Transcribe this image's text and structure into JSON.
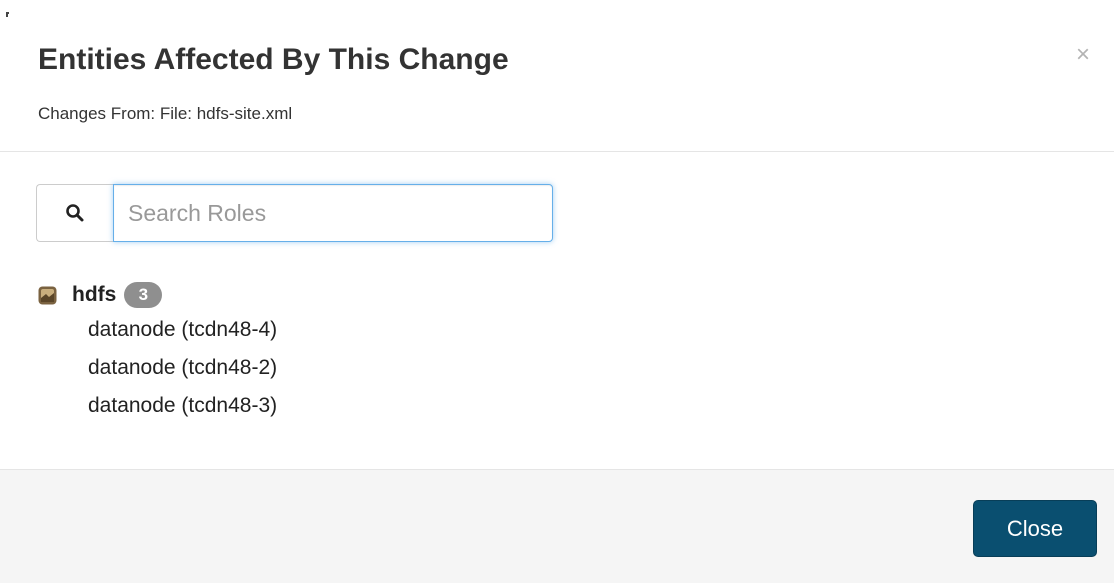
{
  "modal": {
    "title": "Entities Affected By This Change",
    "subtitle": "Changes From: File: hdfs-site.xml",
    "close_x": "×"
  },
  "search": {
    "icon": "search-icon",
    "placeholder": "Search Roles",
    "value": ""
  },
  "service": {
    "icon": "hdfs-service-icon",
    "name": "hdfs",
    "count": "3",
    "roles": [
      "datanode (tcdn48-4)",
      "datanode (tcdn48-2)",
      "datanode (tcdn48-3)"
    ]
  },
  "footer": {
    "close_label": "Close"
  },
  "colors": {
    "primary_button": "#0a4f70",
    "badge": "#8f8f8f",
    "focus_border": "#66afe9",
    "footer_bg": "#f5f5f5"
  }
}
